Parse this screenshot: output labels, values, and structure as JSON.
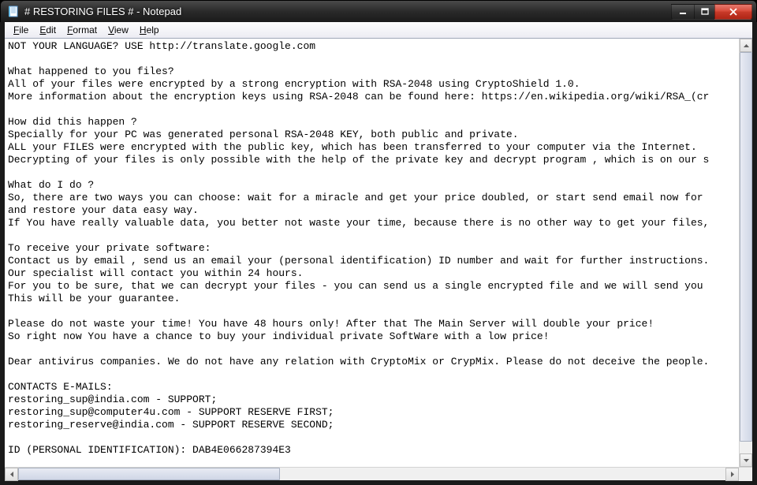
{
  "window": {
    "title": "# RESTORING FILES # - Notepad"
  },
  "menu": {
    "file": "File",
    "edit": "Edit",
    "format": "Format",
    "view": "View",
    "help": "Help"
  },
  "document": {
    "text": "NOT YOUR LANGUAGE? USE http://translate.google.com\n\nWhat happened to you files?\nAll of your files were encrypted by a strong encryption with RSA-2048 using CryptoShield 1.0.\nMore information about the encryption keys using RSA-2048 can be found here: https://en.wikipedia.org/wiki/RSA_(cr\n\nHow did this happen ?\nSpecially for your PC was generated personal RSA-2048 KEY, both public and private.\nALL your FILES were encrypted with the public key, which has been transferred to your computer via the Internet.\nDecrypting of your files is only possible with the help of the private key and decrypt program , which is on our s\n\nWhat do I do ?\nSo, there are two ways you can choose: wait for a miracle and get your price doubled, or start send email now for\nand restore your data easy way.\nIf You have really valuable data, you better not waste your time, because there is no other way to get your files,\n\nTo receive your private software:\nContact us by email , send us an email your (personal identification) ID number and wait for further instructions.\nOur specialist will contact you within 24 hours.\nFor you to be sure, that we can decrypt your files - you can send us a single encrypted file and we will send you\nThis will be your guarantee.\n\nPlease do not waste your time! You have 48 hours only! After that The Main Server will double your price!\nSo right now You have a chance to buy your individual private SoftWare with a low price!\n\nDear antivirus companies. We do not have any relation with CryptoMix or CrypMix. Please do not deceive the people.\n\nCONTACTS E-MAILS:\nrestoring_sup@india.com - SUPPORT;\nrestoring_sup@computer4u.com - SUPPORT RESERVE FIRST;\nrestoring_reserve@india.com - SUPPORT RESERVE SECOND;\n\nID (PERSONAL IDENTIFICATION): DAB4E066287394E3"
  }
}
